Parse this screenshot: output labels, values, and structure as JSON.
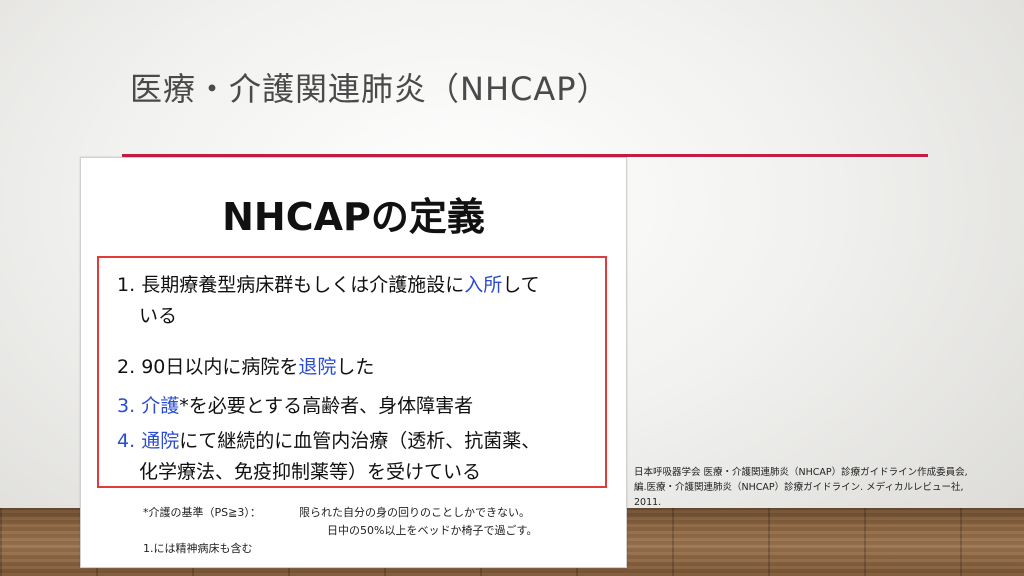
{
  "slide": {
    "title": "医療・介護関連肺炎（NHCAP）",
    "accent_color": "#c21e45"
  },
  "panel": {
    "heading": "NHCAPの定義",
    "box_color": "#e23b3b",
    "highlight_color": "#2a4cd0",
    "items": [
      {
        "num": "1.",
        "pre": "長期療養型病床群もしくは介護施設に",
        "hl": "入所",
        "post": "して",
        "cont": "いる"
      },
      {
        "num": "2.",
        "pre": "90日以内に病院を",
        "hl": "退院",
        "post": "した"
      },
      {
        "num": "3.",
        "pre": "",
        "hl": "介護",
        "post": "*を必要とする高齢者、身体障害者"
      },
      {
        "num": "4.",
        "pre": "",
        "hl": "通院",
        "post": "にて継続的に血管内治療（透析、抗菌薬、",
        "cont": "化学療法、免疫抑制薬等）を受けている"
      }
    ],
    "footnote": {
      "label": "*介護の基準（PS≧3）：",
      "line1": "限られた自分の身の回りのことしかできない。",
      "line2": "日中の50%以上をベッドか椅子で過ごす。",
      "line3": "1.には精神病床も含む"
    }
  },
  "citation": {
    "line1": "日本呼吸器学会 医療・介護関連肺炎（NHCAP）診療ガイドライン作成委員会,",
    "line2": "編.医療・介護関連肺炎（NHCAP）診療ガイドライン. メディカルレビュー社,",
    "line3": "2011."
  }
}
